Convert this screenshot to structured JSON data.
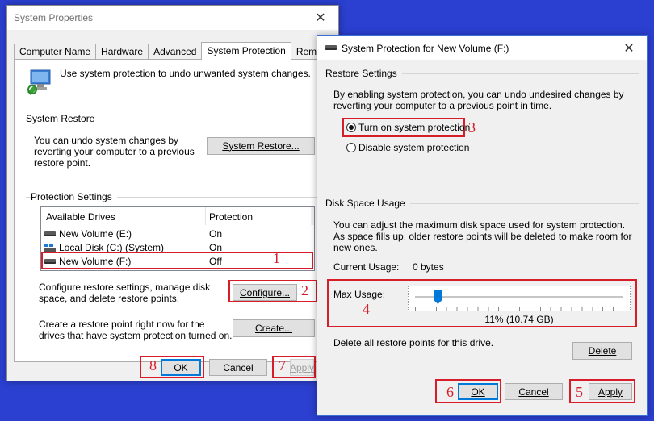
{
  "system_properties": {
    "title": "System Properties",
    "tabs": [
      {
        "label": "Computer Name"
      },
      {
        "label": "Hardware"
      },
      {
        "label": "Advanced"
      },
      {
        "label": "System Protection"
      },
      {
        "label": "Remote"
      }
    ],
    "intro_text": "Use system protection to undo unwanted system changes.",
    "system_restore": {
      "group_label": "System Restore",
      "description": "You can undo system changes by reverting your computer to a previous restore point.",
      "button": "System Restore..."
    },
    "protection_settings": {
      "group_label": "Protection Settings",
      "columns": [
        "Available Drives",
        "Protection"
      ],
      "drives": [
        {
          "name": "New Volume (E:)",
          "protection": "On",
          "icon": "drive-icon"
        },
        {
          "name": "Local Disk (C:) (System)",
          "protection": "On",
          "icon": "system-drive-icon"
        },
        {
          "name": "New Volume (F:)",
          "protection": "Off",
          "icon": "drive-icon"
        }
      ],
      "configure_text": "Configure restore settings, manage disk space, and delete restore points.",
      "configure_button": "Configure...",
      "create_text": "Create a restore point right now for the drives that have system protection turned on.",
      "create_button": "Create..."
    },
    "buttons": {
      "ok": "OK",
      "cancel": "Cancel",
      "apply": "Apply"
    }
  },
  "protection_dialog": {
    "title": "System Protection for New Volume (F:)",
    "restore_settings": {
      "group_label": "Restore Settings",
      "description": "By enabling system protection, you can undo undesired changes by reverting your computer to a previous point in time.",
      "options": [
        {
          "label": "Turn on system protection",
          "selected": true
        },
        {
          "label": "Disable system protection",
          "selected": false
        }
      ]
    },
    "disk_space": {
      "group_label": "Disk Space Usage",
      "description": "You can adjust the maximum disk space used for system protection. As space fills up, older restore points will be deleted to make room for new ones.",
      "current_usage_label": "Current Usage:",
      "current_usage_value": "0 bytes",
      "max_usage_label": "Max Usage:",
      "max_usage_fraction": 0.11,
      "max_usage_value": "11% (10.74 GB)",
      "delete_text": "Delete all restore points for this drive.",
      "delete_button": "Delete"
    },
    "buttons": {
      "ok": "OK",
      "cancel": "Cancel",
      "apply": "Apply"
    }
  },
  "annotations": {
    "numbers": [
      "1",
      "2",
      "3",
      "4",
      "5",
      "6",
      "7",
      "8"
    ],
    "color": "#d81d2a"
  },
  "colors": {
    "background": "#2b3fd0",
    "accent": "#0078d7",
    "annotation": "#d81d2a"
  }
}
